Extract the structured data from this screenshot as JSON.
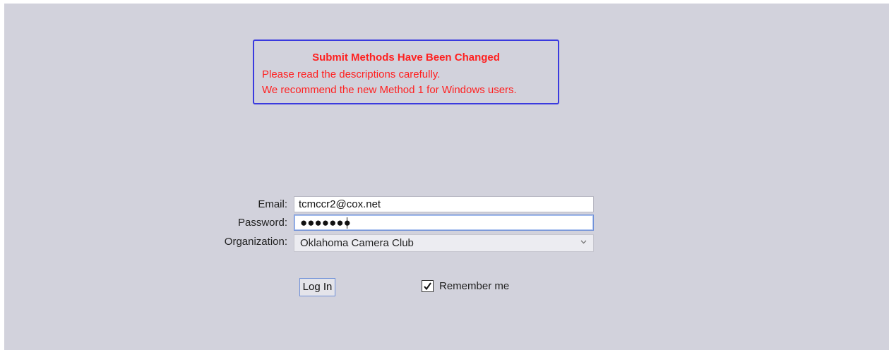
{
  "notice": {
    "title": "Submit Methods Have Been Changed",
    "line1": "Please read the descriptions carefully.",
    "line2": "We recommend the new Method 1 for Windows users.",
    "text_color": "#ff2020",
    "border_color": "#3a3adf"
  },
  "form": {
    "email_label": "Email:",
    "email_value": "tcmccr2@cox.net",
    "password_label": "Password:",
    "password_masked": "●●●●●●●",
    "organization_label": "Organization:",
    "organization_value": "Oklahoma Camera Club",
    "organization_icon": "chevron-down-icon",
    "login_label": "Log In",
    "remember_label": "Remember me",
    "remember_checked": true
  },
  "colors": {
    "background": "#d2d2dc",
    "focus_border": "#6f90d8"
  }
}
